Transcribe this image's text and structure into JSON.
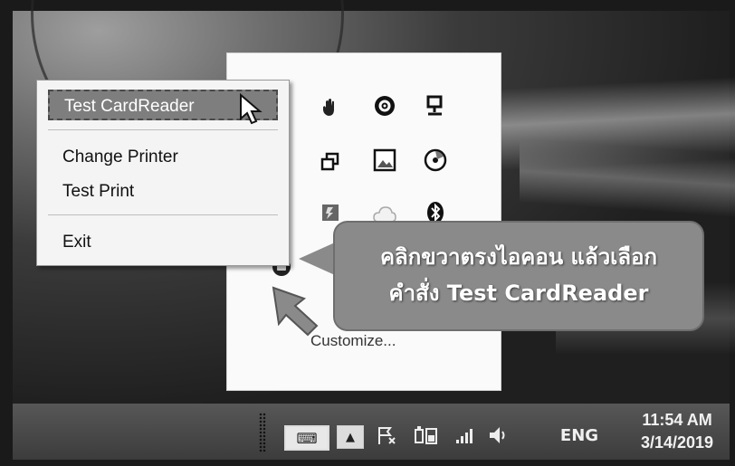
{
  "context_menu": {
    "items": [
      {
        "label": "Test CardReader",
        "highlighted": true
      },
      {
        "label": "Change Printer",
        "highlighted": false
      },
      {
        "label": "Test Print",
        "highlighted": false
      },
      {
        "label": "Exit",
        "highlighted": false
      }
    ]
  },
  "tray_panel": {
    "customize_label": "Customize...",
    "icons": [
      "hand-cursor-icon",
      "gear-circle-icon",
      "network-monitor-icon",
      "copy-window-icon",
      "photo-frame-icon",
      "disc-icon",
      "app-square-icon",
      "cloud-icon",
      "bluetooth-icon",
      "smartcard-app-icon"
    ]
  },
  "callout": {
    "line1": "คลิกขวาตรงไอคอน แล้วเลือก",
    "line2": "คำสั่ง Test CardReader"
  },
  "taskbar": {
    "language": "ENG",
    "time": "11:54 AM",
    "date": "3/14/2019",
    "icons": [
      "keyboard-icon",
      "show-hidden-icons-button",
      "action-center-flag-icon",
      "battery-power-icon",
      "wifi-signal-icon",
      "speaker-icon"
    ]
  },
  "colors": {
    "menu_highlight": "#7e7e7e",
    "callout_bg": "#8a8a8a",
    "taskbar": "#454545"
  }
}
